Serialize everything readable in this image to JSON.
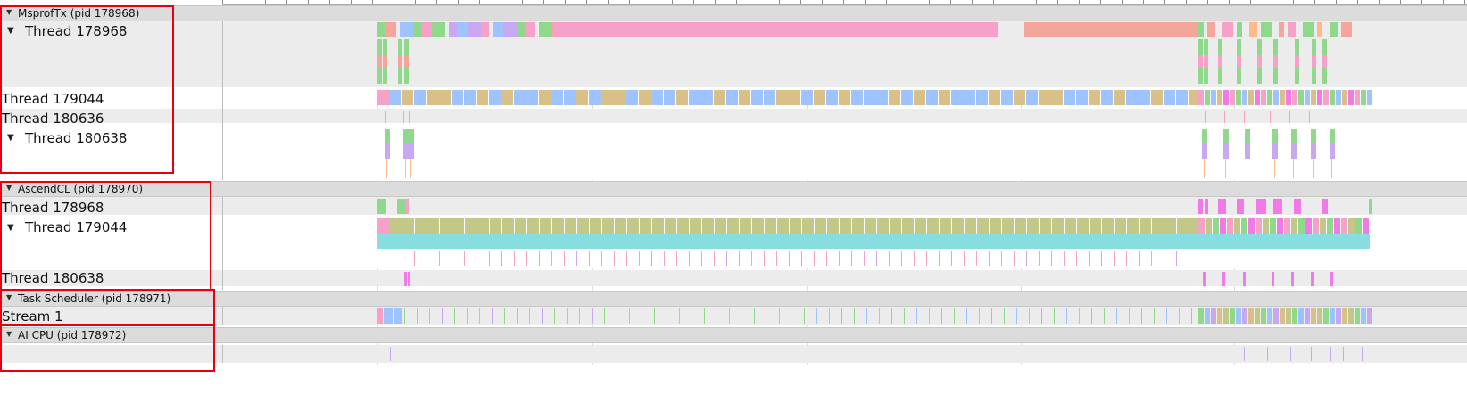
{
  "processes": [
    {
      "title": "MsprofTx (pid 178968)",
      "threads": [
        {
          "label": "Thread 178968",
          "expanded": true
        },
        {
          "label": "Thread 179044",
          "expanded": false
        },
        {
          "label": "Thread 180636",
          "expanded": false
        },
        {
          "label": "Thread 180638",
          "expanded": true
        }
      ]
    },
    {
      "title": "AscendCL (pid 178970)",
      "threads": [
        {
          "label": "Thread 178968",
          "expanded": false
        },
        {
          "label": "Thread 179044",
          "expanded": true
        },
        {
          "label": "Thread 180638",
          "expanded": false
        }
      ]
    },
    {
      "title": "Task Scheduler (pid 178971)",
      "threads": [
        {
          "label": "Stream 1",
          "expanded": false
        }
      ]
    },
    {
      "title": "AI CPU (pid 178972)",
      "threads": []
    }
  ],
  "colors": {
    "green": "#8fd88c",
    "pink": "#f7a0c8",
    "salmon": "#f4a69c",
    "blue": "#9fc3ff",
    "lavender": "#c8a8f0",
    "tan": "#d8c088",
    "olive": "#c2c888",
    "cyan": "#88dde0",
    "magenta": "#f27ae8",
    "orange": "#ffba88",
    "highlight": "#e60012"
  }
}
